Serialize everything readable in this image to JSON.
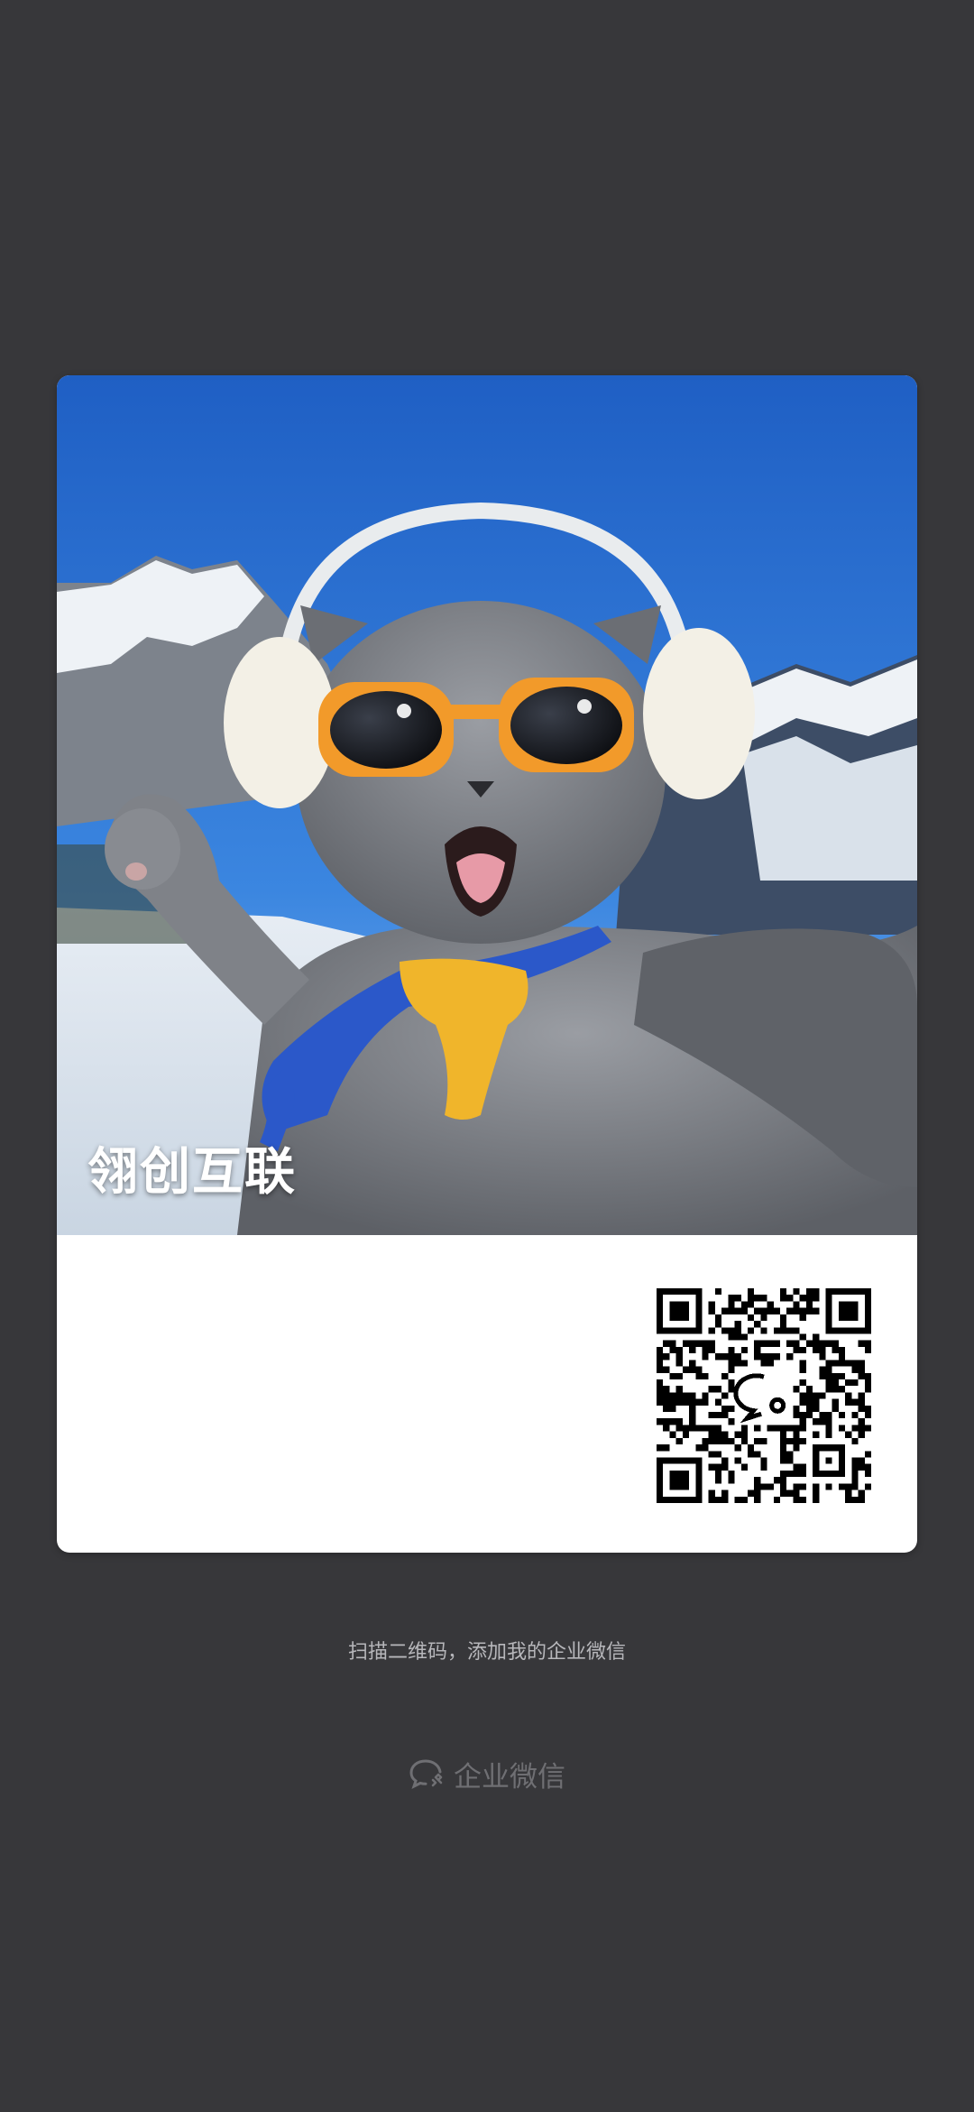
{
  "card": {
    "name": "翎创互联",
    "photo_icon": "cat-with-sunglasses-photo",
    "qr_icon": "qr-code-icon",
    "qr_center_icon": "wecom-logo-icon"
  },
  "caption": "扫描二维码，添加我的企业微信",
  "brand": {
    "label": "企业微信",
    "icon": "wecom-logo-icon"
  },
  "colors": {
    "background": "#37373a",
    "card": "#ffffff",
    "sky": "#2f6fd1",
    "glasses_frame": "#f29a2a",
    "scarf_blue": "#2b58c9",
    "scarf_yellow": "#f0b52b"
  }
}
